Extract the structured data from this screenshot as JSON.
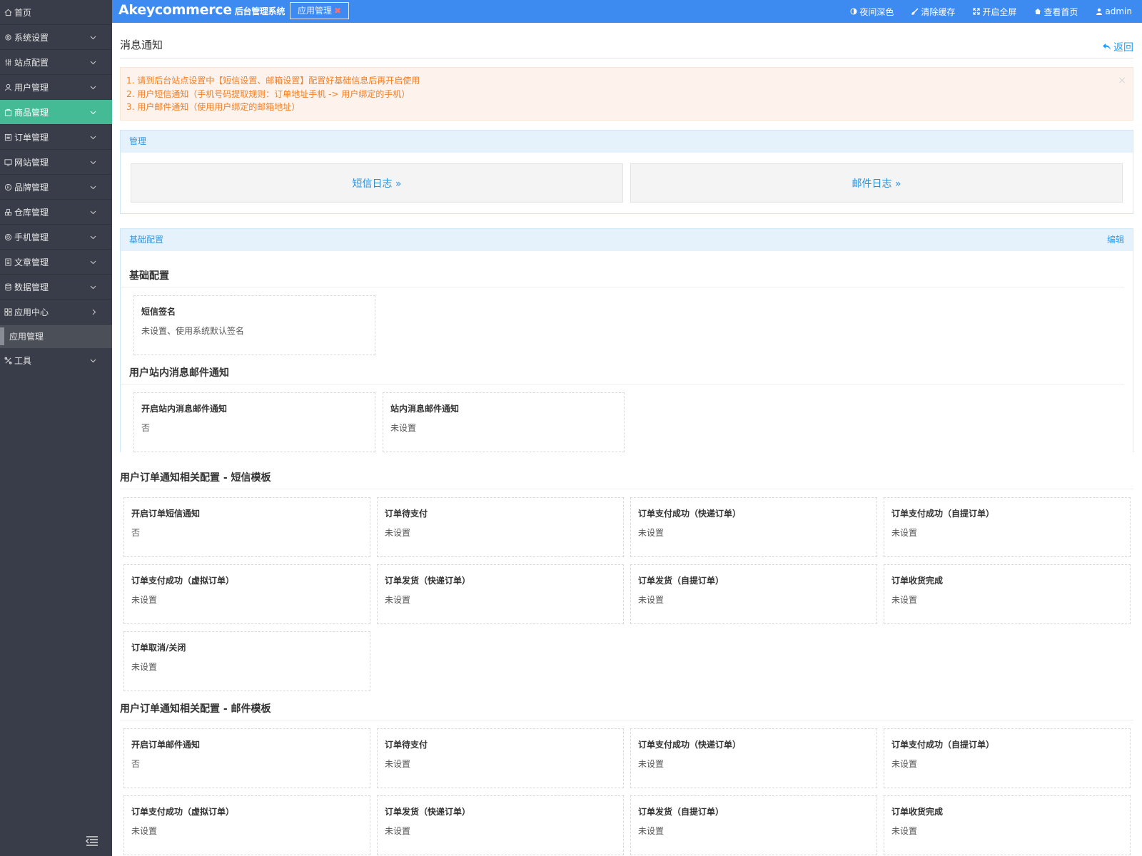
{
  "sidebar": {
    "home": "首页",
    "items": [
      {
        "label": "系统设置",
        "icon": "gear-icon"
      },
      {
        "label": "站点配置",
        "icon": "sliders-icon"
      },
      {
        "label": "用户管理",
        "icon": "user-icon"
      },
      {
        "label": "商品管理",
        "icon": "bag-icon"
      },
      {
        "label": "订单管理",
        "icon": "list-icon"
      },
      {
        "label": "网站管理",
        "icon": "site-icon"
      },
      {
        "label": "品牌管理",
        "icon": "brand-icon"
      },
      {
        "label": "仓库管理",
        "icon": "warehouse-icon"
      },
      {
        "label": "手机管理",
        "icon": "phone-icon"
      },
      {
        "label": "文章管理",
        "icon": "article-icon"
      },
      {
        "label": "数据管理",
        "icon": "database-icon"
      },
      {
        "label": "应用中心",
        "icon": "apps-icon"
      }
    ],
    "sub_item": "应用管理",
    "tools": "工具",
    "active_color": "#45bb95"
  },
  "header": {
    "brand": "Akeycommerce",
    "brand_sub": "后台管理系统",
    "tab_label": "应用管理",
    "links": [
      "夜间深色",
      "清除缓存",
      "开启全屏",
      "查看首页",
      "admin"
    ]
  },
  "page": {
    "title": "消息通知",
    "back": "返回"
  },
  "alert": {
    "lines": [
      "1. 请到后台站点设置中【短信设置、邮箱设置】配置好基础信息后再开启使用",
      "2. 用户短信通知（手机号码提取规则：订单地址手机 -> 用户绑定的手机）",
      "3. 用户邮件通知（使用用户绑定的邮箱地址）"
    ],
    "close": "×"
  },
  "manage": {
    "title": "管理",
    "sms_log": "短信日志 »",
    "mail_log": "邮件日志 »"
  },
  "config": {
    "title": "基础配置",
    "edit": "编辑",
    "basic": {
      "title": "基础配置",
      "items": [
        {
          "label": "短信签名",
          "value": "未设置、使用系统默认签名"
        }
      ]
    },
    "station": {
      "title": "用户站内消息邮件通知",
      "items": [
        {
          "label": "开启站内消息邮件通知",
          "value": "否"
        },
        {
          "label": "站内消息邮件通知",
          "value": "未设置"
        }
      ]
    },
    "sms": {
      "title": "用户订单通知相关配置 - 短信模板",
      "items": [
        {
          "label": "开启订单短信通知",
          "value": "否"
        },
        {
          "label": "订单待支付",
          "value": "未设置"
        },
        {
          "label": "订单支付成功（快递订单）",
          "value": "未设置"
        },
        {
          "label": "订单支付成功（自提订单）",
          "value": "未设置"
        },
        {
          "label": "订单支付成功（虚拟订单）",
          "value": "未设置"
        },
        {
          "label": "订单发货（快递订单）",
          "value": "未设置"
        },
        {
          "label": "订单发货（自提订单）",
          "value": "未设置"
        },
        {
          "label": "订单收货完成",
          "value": "未设置"
        },
        {
          "label": "订单取消/关闭",
          "value": "未设置"
        }
      ]
    },
    "mail": {
      "title": "用户订单通知相关配置 - 邮件模板",
      "items": [
        {
          "label": "开启订单邮件通知",
          "value": "否"
        },
        {
          "label": "订单待支付",
          "value": "未设置"
        },
        {
          "label": "订单支付成功（快递订单）",
          "value": "未设置"
        },
        {
          "label": "订单支付成功（自提订单）",
          "value": "未设置"
        },
        {
          "label": "订单支付成功（虚拟订单）",
          "value": "未设置"
        },
        {
          "label": "订单发货（快递订单）",
          "value": "未设置"
        },
        {
          "label": "订单发货（自提订单）",
          "value": "未设置"
        },
        {
          "label": "订单收货完成",
          "value": "未设置"
        }
      ]
    }
  }
}
